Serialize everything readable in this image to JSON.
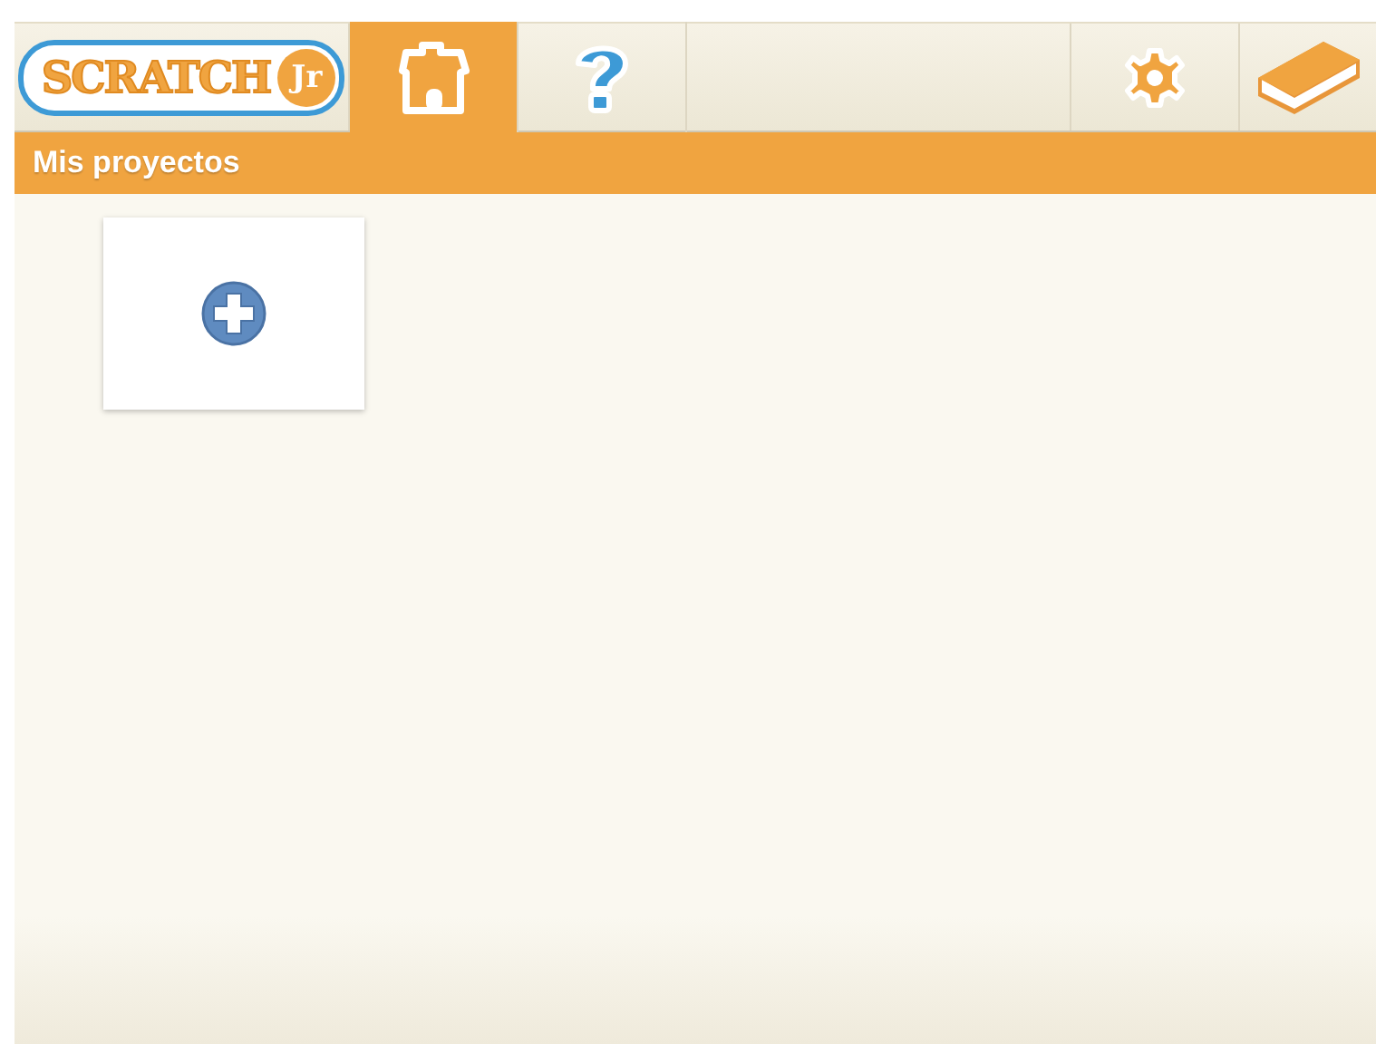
{
  "logo": {
    "word": "SCRATCH",
    "badge": "Jr"
  },
  "tabs": [
    {
      "kind": "home",
      "selected": true
    },
    {
      "kind": "help",
      "selected": false
    }
  ],
  "tools": [
    {
      "kind": "settings"
    },
    {
      "kind": "book"
    }
  ],
  "title_bar": {
    "title": "Mis proyectos"
  },
  "projects": [
    {
      "kind": "new"
    }
  ]
}
